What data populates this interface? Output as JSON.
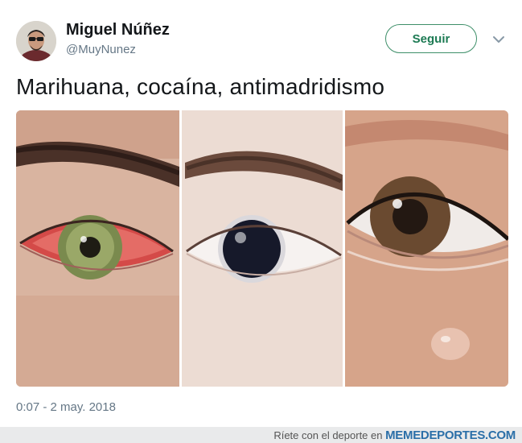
{
  "user": {
    "name": "Miguel Núñez",
    "handle": "@MuyNunez",
    "avatar_icon": "profile-photo"
  },
  "follow_button": {
    "label": "Seguir",
    "color": "#1c7a53"
  },
  "menu_icon": "chevron-down-icon",
  "tweet": {
    "text": "Marihuana, cocaína, antimadridismo",
    "timestamp": "0:07 - 2 may. 2018"
  },
  "media": {
    "panels": [
      "red-eye",
      "dilated-pupil-eye",
      "crying-eye"
    ]
  },
  "watermark": {
    "prefix": "Ríete con el deporte en",
    "site": "MEMEDEPORTES.COM"
  }
}
